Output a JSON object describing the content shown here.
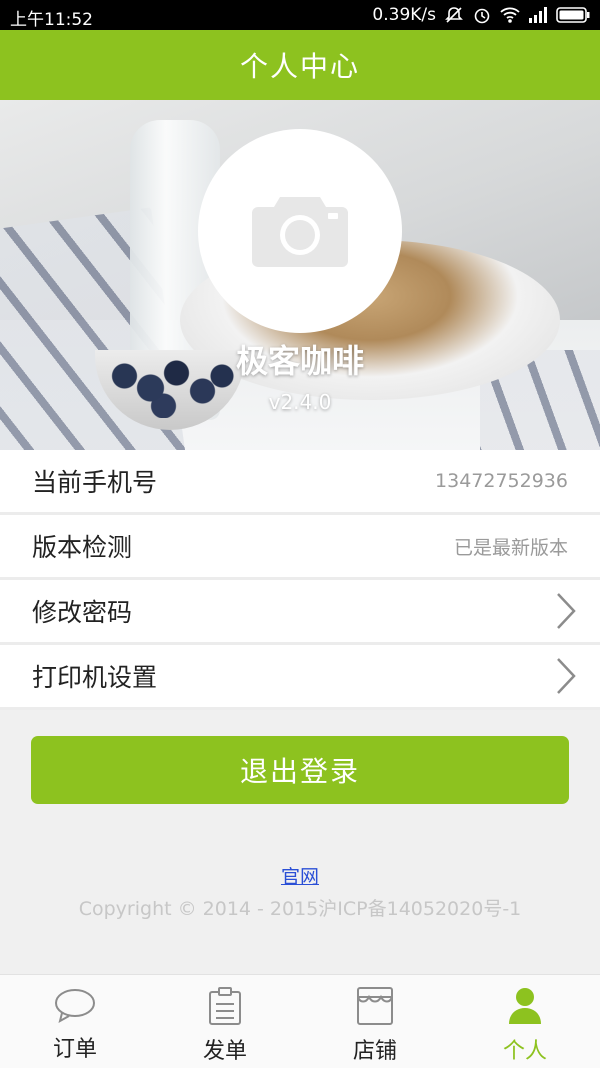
{
  "status_bar": {
    "time": "上午11:52",
    "net_speed": "0.39K/s"
  },
  "header": {
    "title": "个人中心"
  },
  "profile": {
    "avatar_icon": "camera-icon",
    "store_name": "极客咖啡",
    "version": "v2.4.0"
  },
  "settings": [
    {
      "label": "当前手机号",
      "value": "13472752936"
    },
    {
      "label": "版本检测",
      "value": "已是最新版本"
    },
    {
      "label": "修改密码",
      "icon": "chevron-right-icon"
    },
    {
      "label": "打印机设置",
      "icon": "chevron-right-icon"
    }
  ],
  "logout_label": "退出登录",
  "footer": {
    "official_link": "官网",
    "copyright": "Copyright © 2014 - 2015沪ICP备14052020号-1"
  },
  "bottom_nav": [
    {
      "label": "订单",
      "icon": "chat-bubble-icon"
    },
    {
      "label": "发单",
      "icon": "clipboard-icon"
    },
    {
      "label": "店铺",
      "icon": "store-icon"
    },
    {
      "label": "个人",
      "icon": "person-icon",
      "active": true
    }
  ],
  "colors": {
    "accent": "#8dc21f",
    "link": "#2a4fd6"
  }
}
